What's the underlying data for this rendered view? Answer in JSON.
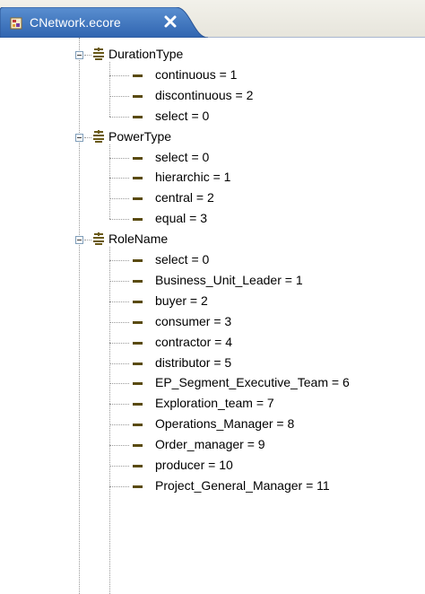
{
  "editor": {
    "tab_title": "CNetwork.ecore",
    "tab_icon": "ecore-file-icon",
    "close_icon": "close-icon"
  },
  "tree": {
    "enums": [
      {
        "name": "DurationType",
        "literals": [
          "continuous = 1",
          "discontinuous = 2",
          "select = 0"
        ]
      },
      {
        "name": "PowerType",
        "literals": [
          "select = 0",
          "hierarchic = 1",
          "central = 2",
          "equal = 3"
        ]
      },
      {
        "name": "RoleName",
        "literals": [
          "select = 0",
          "Business_Unit_Leader = 1",
          "buyer = 2",
          "consumer = 3",
          "contractor = 4",
          "distributor = 5",
          "EP_Segment_Executive_Team = 6",
          "Exploration_team = 7",
          "Operations_Manager = 8",
          "Order_manager = 9",
          "producer = 10",
          "Project_General_Manager = 11"
        ]
      }
    ]
  },
  "colors": {
    "tab_active": "#3a6ea5",
    "literal_icon": "#5a4b10"
  }
}
